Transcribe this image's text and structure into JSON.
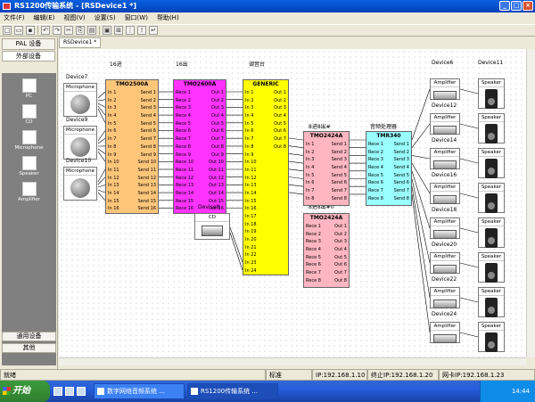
{
  "window": {
    "title": "RS1200传输系统 - [RSDevice1 *]"
  },
  "menu": [
    "文件(F)",
    "编辑(E)",
    "视图(V)",
    "设置(S)",
    "窗口(W)",
    "帮助(H)"
  ],
  "sidebar": {
    "header": "PAL 设备",
    "section": "外部设备",
    "items": [
      {
        "label": "PC",
        "icon": "pc-icon"
      },
      {
        "label": "CD",
        "icon": "cd-icon"
      },
      {
        "label": "Microphone",
        "icon": "microphone-icon"
      },
      {
        "label": "Speaker",
        "icon": "speaker-icon"
      },
      {
        "label": "Amplifier",
        "icon": "amplifier-icon"
      }
    ],
    "footer_common": "通用设备",
    "footer_other": "其他"
  },
  "doc_tab": "RSDevice1 *",
  "canvas": {
    "mics": [
      {
        "label": "Microphone",
        "caption": "Device7"
      },
      {
        "label": "Microphone",
        "caption": "Device9"
      },
      {
        "label": "Microphone",
        "caption": "Device10"
      }
    ],
    "group_labels": {
      "in16": "16进",
      "out16": "16出",
      "mixer": "调音台",
      "in8out8a": "8进8出#",
      "in8out8b": "8进8出#0",
      "proc": "音频处理器",
      "dev6": "Device6",
      "dev11": "Device11"
    },
    "tmo2500": {
      "title": "TMO2500A",
      "ins": [
        "In 1",
        "In 2",
        "In 3",
        "In 4",
        "In 5",
        "In 6",
        "In 7",
        "In 8",
        "In 9",
        "In 10",
        "In 11",
        "In 12",
        "In 13",
        "In 14",
        "In 15",
        "In 16"
      ],
      "outs": [
        "Send 1",
        "Send 2",
        "Send 3",
        "Send 4",
        "Send 5",
        "Send 6",
        "Send 7",
        "Send 8",
        "Send 9",
        "Send 10",
        "Send 11",
        "Send 12",
        "Send 13",
        "Send 14",
        "Send 15",
        "Send 16"
      ]
    },
    "tmo2600": {
      "title": "TMO2600A",
      "ins": [
        "Rece 1",
        "Rece 2",
        "Rece 3",
        "Rece 4",
        "Rece 5",
        "Rece 6",
        "Rece 7",
        "Rece 8",
        "Rece 9",
        "Rece 10",
        "Rece 11",
        "Rece 12",
        "Rece 13",
        "Rece 14",
        "Rece 15",
        "Rece 16"
      ],
      "outs": [
        "Out 1",
        "Out 2",
        "Out 3",
        "Out 4",
        "Out 5",
        "Out 6",
        "Out 7",
        "Out 8",
        "Out 9",
        "Out 10",
        "Out 11",
        "Out 12",
        "Out 13",
        "Out 14",
        "Out 15",
        "Out 16"
      ]
    },
    "generic": {
      "title": "GENERIC",
      "ins": [
        "In 1",
        "In 2",
        "In 3",
        "In 4",
        "In 5",
        "In 6",
        "In 7",
        "In 8",
        "In 9",
        "In 10",
        "In 11",
        "In 12",
        "In 13",
        "In 14",
        "In 15",
        "In 16",
        "In 17",
        "In 18",
        "In 19",
        "In 20",
        "In 21",
        "In 22",
        "In 23",
        "In 24"
      ],
      "outs": [
        "Out 1",
        "Out 2",
        "Out 3",
        "Out 4",
        "Out 5",
        "Out 6",
        "Out 7",
        "Out 8"
      ]
    },
    "tmo2424a": {
      "title": "TMO2424A",
      "ins": [
        "In 1",
        "In 2",
        "In 3",
        "In 4",
        "In 5",
        "In 6",
        "In 7",
        "In 8"
      ],
      "outs": [
        "Send 1",
        "Send 2",
        "Send 3",
        "Send 4",
        "Send 5",
        "Send 6",
        "Send 7",
        "Send 8"
      ]
    },
    "tmo2424b": {
      "title": "TMO2424A",
      "ins": [
        "Rece 1",
        "Rece 2",
        "Rece 3",
        "Rece 4",
        "Rece 5",
        "Rece 6",
        "Rece 7",
        "Rece 8"
      ],
      "outs": [
        "Out 1",
        "Out 2",
        "Out 3",
        "Out 4",
        "Out 5",
        "Out 6",
        "Out 7",
        "Out 8"
      ]
    },
    "tmr340": {
      "title": "TMR340",
      "ins": [
        "Rece 1",
        "Rece 2",
        "Rece 3",
        "Rece 4",
        "Rece 5",
        "Rece 6",
        "Rece 7",
        "Rece 8"
      ],
      "outs": [
        "Send 1",
        "Send 2",
        "Send 3",
        "Send 4",
        "Send 5",
        "Send 6",
        "Send 7",
        "Send 8"
      ]
    },
    "cd": {
      "label": "CD",
      "caption": "Device8"
    },
    "amps": [
      {
        "label": "Amplifier",
        "caption": "Device12"
      },
      {
        "label": "Amplifier",
        "caption": "Device14"
      },
      {
        "label": "Amplifier",
        "caption": "Device16"
      },
      {
        "label": "Amplifier",
        "caption": "Device18"
      },
      {
        "label": "Amplifier",
        "caption": "Device20"
      },
      {
        "label": "Amplifier",
        "caption": "Device22"
      },
      {
        "label": "Amplifier",
        "caption": "Device24"
      },
      {
        "label": "Amplifier",
        "caption": ""
      }
    ],
    "speakers": [
      {
        "label": "Speaker",
        "caption": "Device13"
      },
      {
        "label": "Speaker",
        "caption": "Device15"
      },
      {
        "label": "Speaker",
        "caption": "Device17"
      },
      {
        "label": "Speaker",
        "caption": "Device19"
      },
      {
        "label": "Speaker",
        "caption": "Device21"
      },
      {
        "label": "Speaker",
        "caption": "Device23"
      },
      {
        "label": "Speaker",
        "caption": "Device25"
      },
      {
        "label": "Speaker",
        "caption": ""
      }
    ],
    "colors": {
      "tmo2500": "#ffc67a",
      "tmo2600": "#ff33ff",
      "generic": "#ffff00",
      "tmo2424": "#ffb6c1",
      "tmr340": "#99ffff"
    }
  },
  "status": {
    "ready": "就绪",
    "mode": "标准",
    "ip1": "IP:192.168.1.10",
    "ip2": "终止IP:192.168.1.20",
    "ip3": "网卡IP:192.168.1.23"
  },
  "taskbar": {
    "start": "开始",
    "tasks": [
      "数字网络音频系统 ...",
      "RS1200传输系统 ..."
    ],
    "clock": "14:44"
  }
}
